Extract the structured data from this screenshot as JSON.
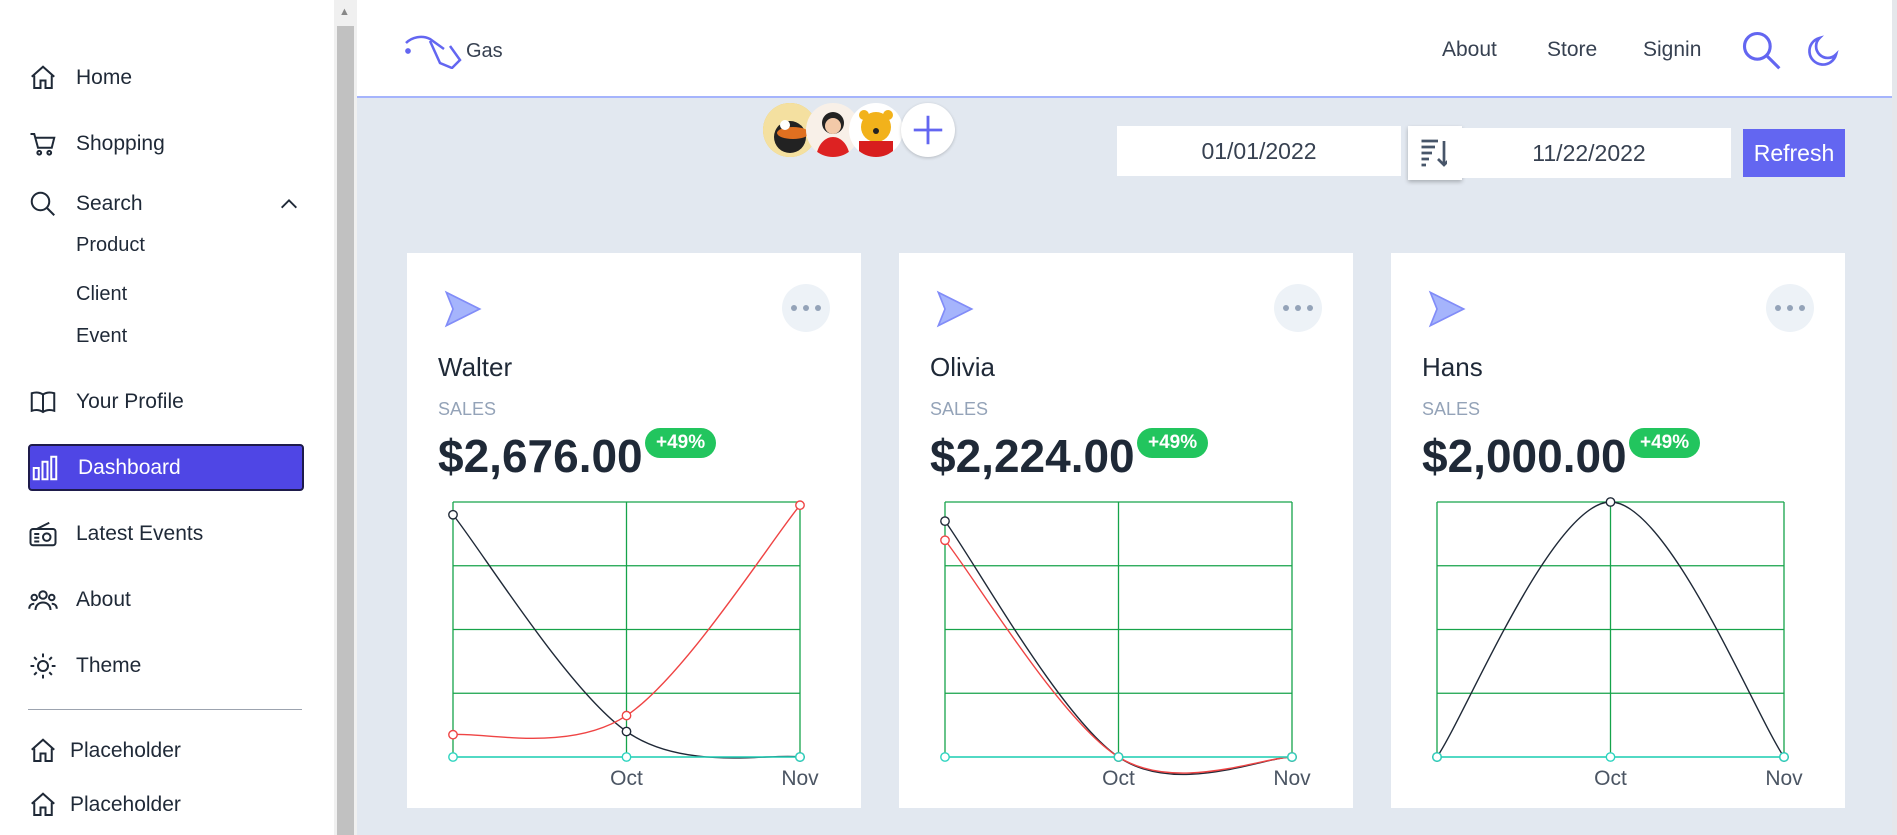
{
  "sidebar": {
    "items": [
      {
        "label": "Home"
      },
      {
        "label": "Shopping"
      },
      {
        "label": "Search"
      },
      {
        "label": "Your Profile"
      },
      {
        "label": "Dashboard"
      },
      {
        "label": "Latest Events"
      },
      {
        "label": "About"
      },
      {
        "label": "Theme"
      }
    ],
    "search_subitems": [
      "Product",
      "Client",
      "Event"
    ],
    "footer_items": [
      {
        "label": "Placeholder"
      },
      {
        "label": "Placeholder"
      }
    ]
  },
  "header": {
    "logo_text": "Gas",
    "links": [
      "About",
      "Store",
      "Signin"
    ]
  },
  "toolbar": {
    "date_from": "01/01/2022",
    "date_separator": "-",
    "date_to": "11/22/2022",
    "refresh_label": "Refresh"
  },
  "cards": [
    {
      "name": "Walter",
      "label": "SALES",
      "amount": "$2,676.00",
      "badge": "+49%"
    },
    {
      "name": "Olivia",
      "label": "SALES",
      "amount": "$2,224.00",
      "badge": "+49%"
    },
    {
      "name": "Hans",
      "label": "SALES",
      "amount": "$2,000.00",
      "badge": "+49%"
    }
  ],
  "colors": {
    "accent": "#4f46e5",
    "button": "#6366f1",
    "badge": "#22c55e",
    "grid": "#16a34a"
  },
  "chart_data": [
    {
      "type": "line",
      "x": [
        "",
        "Oct",
        "Nov"
      ],
      "ylim": [
        0,
        4
      ],
      "series": [
        {
          "color": "#1f2937",
          "values": [
            3.8,
            0.4,
            0
          ]
        },
        {
          "color": "#ef4444",
          "values": [
            0.35,
            0.65,
            3.95
          ]
        },
        {
          "color": "#2dd4bf",
          "values": [
            0,
            0,
            0
          ]
        }
      ]
    },
    {
      "type": "line",
      "x": [
        "",
        "Oct",
        "Nov"
      ],
      "ylim": [
        0,
        4
      ],
      "series": [
        {
          "color": "#1f2937",
          "values": [
            3.7,
            0,
            0
          ]
        },
        {
          "color": "#ef4444",
          "values": [
            3.4,
            0,
            0
          ]
        },
        {
          "color": "#2dd4bf",
          "values": [
            0,
            0,
            0
          ]
        }
      ]
    },
    {
      "type": "line",
      "x": [
        "",
        "Oct",
        "Nov"
      ],
      "ylim": [
        0,
        4
      ],
      "series": [
        {
          "color": "#1f2937",
          "values": [
            0,
            4,
            0
          ]
        },
        {
          "color": "#2dd4bf",
          "values": [
            0,
            0,
            0
          ]
        }
      ]
    }
  ]
}
